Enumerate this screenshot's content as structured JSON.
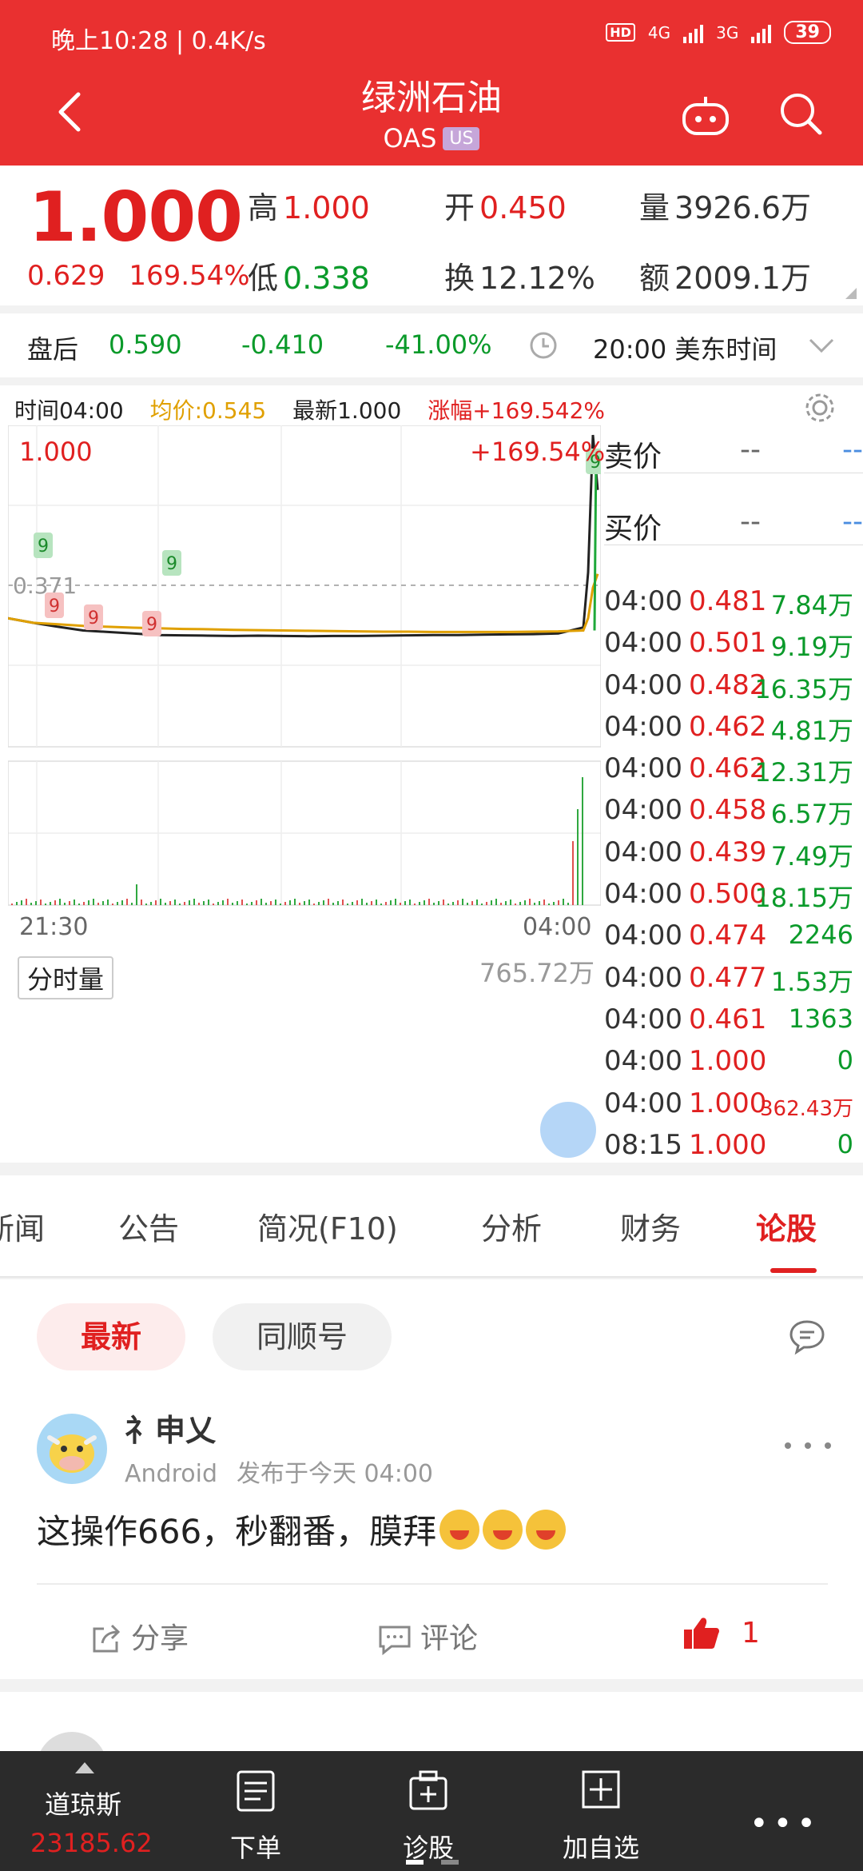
{
  "status_bar": {
    "time_speed": "晚上10:28 | 0.4K/s",
    "net_4g": "4G",
    "net_3g": "3G",
    "hd": "HD",
    "battery": "39"
  },
  "header": {
    "title": "绿洲石油",
    "code": "OAS",
    "market_tag": "US"
  },
  "quote": {
    "price": "1.000",
    "change": "0.629",
    "change_pct": "169.54%",
    "high_label": "高",
    "high": "1.000",
    "open_label": "开",
    "open": "0.450",
    "volume_label": "量",
    "volume": "3926.6万",
    "low_label": "低",
    "low": "0.338",
    "turnover_label": "换",
    "turnover": "12.12%",
    "amount_label": "额",
    "amount": "2009.1万"
  },
  "after_hours": {
    "label": "盘后",
    "price": "0.590",
    "change": "-0.410",
    "change_pct": "-41.00%",
    "time": "20:00 美东时间"
  },
  "chart_legend": {
    "time": "时间04:00",
    "avg": "均价:0.545",
    "latest": "最新1.000",
    "pct": "涨幅+169.542%"
  },
  "chart_data": {
    "type": "line",
    "price_high_label": "1.000",
    "pct_high_label": "+169.54%",
    "ref_label": "0.371",
    "x_start": "21:30",
    "x_end": "04:00",
    "volume_button": "分时量",
    "volume_max": "765.72万",
    "signal_marker": "9",
    "series": [
      {
        "values": [
          0.4,
          0.385,
          0.372,
          0.36,
          0.355,
          0.35,
          0.345,
          0.344,
          0.343,
          0.342,
          0.343,
          0.342,
          0.341,
          0.342,
          0.342,
          0.343,
          0.344,
          0.345,
          0.345,
          0.346,
          0.347,
          0.348,
          0.35,
          0.37,
          0.55,
          1.0,
          0.82
        ]
      },
      {
        "values": [
          0.4,
          0.385,
          0.38,
          0.375,
          0.372,
          0.369,
          0.367,
          0.365,
          0.364,
          0.362,
          0.361,
          0.36,
          0.359,
          0.358,
          0.357,
          0.356,
          0.356,
          0.355,
          0.355,
          0.355,
          0.355,
          0.356,
          0.357,
          0.36,
          0.4,
          0.5,
          0.545
        ]
      }
    ]
  },
  "orderbook": {
    "ask_label": "卖价",
    "ask_value": "--",
    "ask_vol": "--",
    "bid_label": "买价",
    "bid_value": "--",
    "bid_vol": "--"
  },
  "trades": [
    {
      "time": "04:00",
      "price": "0.481",
      "vol": "7.84万"
    },
    {
      "time": "04:00",
      "price": "0.501",
      "vol": "9.19万"
    },
    {
      "time": "04:00",
      "price": "0.482",
      "vol": "16.35万"
    },
    {
      "time": "04:00",
      "price": "0.462",
      "vol": "4.81万"
    },
    {
      "time": "04:00",
      "price": "0.462",
      "vol": "12.31万"
    },
    {
      "time": "04:00",
      "price": "0.458",
      "vol": "6.57万"
    },
    {
      "time": "04:00",
      "price": "0.439",
      "vol": "7.49万"
    },
    {
      "time": "04:00",
      "price": "0.500",
      "vol": "18.15万"
    },
    {
      "time": "04:00",
      "price": "0.474",
      "vol": "2246"
    },
    {
      "time": "04:00",
      "price": "0.477",
      "vol": "1.53万"
    },
    {
      "time": "04:00",
      "price": "0.461",
      "vol": "1363"
    },
    {
      "time": "04:00",
      "price": "1.000",
      "vol": "0"
    },
    {
      "time": "04:00",
      "price": "1.000",
      "vol": "362.43万"
    },
    {
      "time": "08:15",
      "price": "1.000",
      "vol": "0"
    }
  ],
  "tabs": [
    "新闻",
    "公告",
    "简况(F10)",
    "分析",
    "财务",
    "论股"
  ],
  "feed": {
    "filter_latest": "最新",
    "filter_tonghuashun": "同顺号",
    "post": {
      "user": "礻申乂",
      "platform": "Android",
      "time": "发布于今天 04:00",
      "text": "这操作666，秒翻番，膜拜",
      "share": "分享",
      "comment": "评论",
      "likes": "1"
    }
  },
  "bottom_nav": {
    "index_name": "道琼斯",
    "index_value": "23185.62",
    "order": "下单",
    "diagnose": "诊股",
    "add_watch": "加自选",
    "more": "•••"
  }
}
